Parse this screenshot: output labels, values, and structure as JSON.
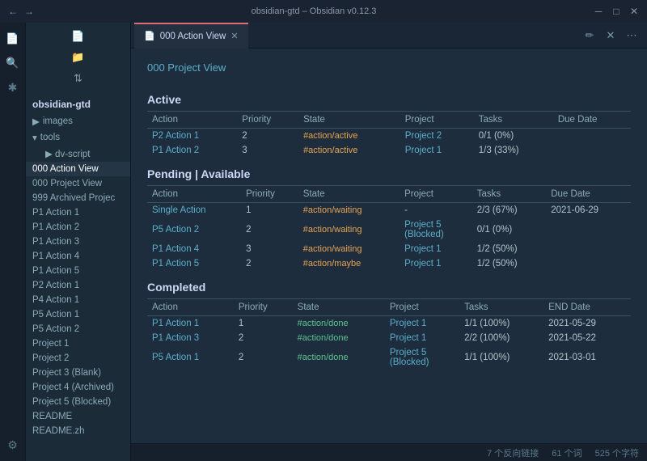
{
  "window": {
    "title": "obsidian-gtd – Obsidian v0.12.3",
    "tab_title": "000 Action View",
    "tab_icon": "file-icon"
  },
  "sidebar": {
    "header": "obsidian-gtd",
    "items": [
      {
        "label": "images",
        "type": "folder",
        "indent": 1
      },
      {
        "label": "tools",
        "type": "folder",
        "indent": 1
      },
      {
        "label": "dv-script",
        "type": "folder",
        "indent": 2
      },
      {
        "label": "000 Action View",
        "type": "file",
        "indent": 0,
        "active": true
      },
      {
        "label": "000 Project View",
        "type": "file",
        "indent": 0
      },
      {
        "label": "999 Archived Projec",
        "type": "file",
        "indent": 0
      },
      {
        "label": "P1 Action 1",
        "type": "file",
        "indent": 0
      },
      {
        "label": "P1 Action 2",
        "type": "file",
        "indent": 0
      },
      {
        "label": "P1 Action 3",
        "type": "file",
        "indent": 0
      },
      {
        "label": "P1 Action 4",
        "type": "file",
        "indent": 0
      },
      {
        "label": "P1 Action 5",
        "type": "file",
        "indent": 0
      },
      {
        "label": "P2 Action 1",
        "type": "file",
        "indent": 0
      },
      {
        "label": "P4 Action 1",
        "type": "file",
        "indent": 0
      },
      {
        "label": "P5 Action 1",
        "type": "file",
        "indent": 0
      },
      {
        "label": "P5 Action 2",
        "type": "file",
        "indent": 0
      },
      {
        "label": "Project 1",
        "type": "file",
        "indent": 0
      },
      {
        "label": "Project 2",
        "type": "file",
        "indent": 0
      },
      {
        "label": "Project 3 (Blank)",
        "type": "file",
        "indent": 0
      },
      {
        "label": "Project 4 (Archived)",
        "type": "file",
        "indent": 0
      },
      {
        "label": "Project 5 (Blocked)",
        "type": "file",
        "indent": 0
      },
      {
        "label": "README",
        "type": "file",
        "indent": 0
      },
      {
        "label": "README.zh",
        "type": "file",
        "indent": 0
      }
    ]
  },
  "content": {
    "project_link": "000 Project View",
    "sections": {
      "active": {
        "heading": "Active",
        "columns": [
          "Action",
          "Priority",
          "State",
          "Project",
          "Tasks",
          "Due Date"
        ],
        "rows": [
          {
            "action": "P2 Action 1",
            "priority": "2",
            "state": "#action/active",
            "project": "Project 2",
            "tasks": "0/1 (0%)",
            "due_date": ""
          },
          {
            "action": "P1 Action 2",
            "priority": "3",
            "state": "#action/active",
            "project": "Project 1",
            "tasks": "1/3 (33%)",
            "due_date": ""
          }
        ]
      },
      "pending": {
        "heading": "Pending | Available",
        "columns": [
          "Action",
          "Priority",
          "State",
          "Project",
          "Tasks",
          "Due Date"
        ],
        "rows": [
          {
            "action": "Single Action",
            "priority": "1",
            "state": "#action/waiting",
            "project": "-",
            "tasks": "2/3 (67%)",
            "due_date": "2021-06-29"
          },
          {
            "action": "P5 Action 2",
            "priority": "2",
            "state": "#action/waiting",
            "project": "Project 5 (Blocked)",
            "tasks": "0/1 (0%)",
            "due_date": ""
          },
          {
            "action": "P1 Action 4",
            "priority": "3",
            "state": "#action/waiting",
            "project": "Project 1",
            "tasks": "1/2 (50%)",
            "due_date": ""
          },
          {
            "action": "P1 Action 5",
            "priority": "2",
            "state": "#action/maybe",
            "project": "Project 1",
            "tasks": "1/2 (50%)",
            "due_date": ""
          }
        ]
      },
      "completed": {
        "heading": "Completed",
        "columns": [
          "Action",
          "Priority",
          "State",
          "Project",
          "Tasks",
          "END Date"
        ],
        "rows": [
          {
            "action": "P1 Action 1",
            "priority": "1",
            "state": "#action/done",
            "project": "Project 1",
            "tasks": "1/1 (100%)",
            "end_date": "2021-05-29"
          },
          {
            "action": "P1 Action 3",
            "priority": "2",
            "state": "#action/done",
            "project": "Project 1",
            "tasks": "2/2 (100%)",
            "end_date": "2021-05-22"
          },
          {
            "action": "P5 Action 1",
            "priority": "2",
            "state": "#action/done",
            "project": "Project 5 (Blocked)",
            "tasks": "1/1 (100%)",
            "end_date": "2021-03-01"
          }
        ]
      }
    }
  },
  "status_bar": {
    "backlinks": "7 个反向链接",
    "words": "61 个词",
    "chars": "525 个字符"
  },
  "icons": {
    "back": "←",
    "forward": "→",
    "file": "📄",
    "folder": "📁",
    "sort": "⇅",
    "search": "🔍",
    "new_file": "📄",
    "new_folder": "📁",
    "pencil": "✏",
    "close": "✕",
    "more": "⋯",
    "minimize": "─",
    "maximize": "□",
    "window_close": "✕",
    "chevron_right": "▶",
    "chevron_down": "▾"
  }
}
